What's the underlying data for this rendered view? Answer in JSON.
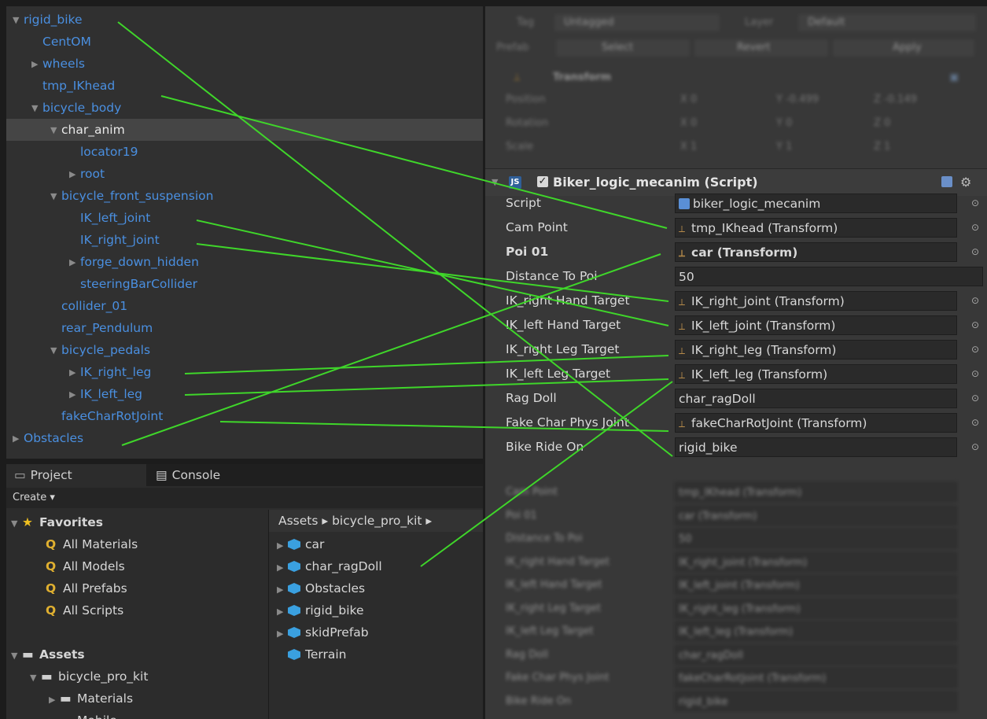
{
  "hierarchy": {
    "items": [
      {
        "label": "rigid_bike",
        "arrow": "open",
        "indent": 0
      },
      {
        "label": "CentOM",
        "arrow": "none",
        "indent": 1
      },
      {
        "label": "wheels",
        "arrow": "closed",
        "indent": 1
      },
      {
        "label": "tmp_IKhead",
        "arrow": "none",
        "indent": 1
      },
      {
        "label": "bicycle_body",
        "arrow": "open",
        "indent": 1
      },
      {
        "label": "char_anim",
        "arrow": "open",
        "indent": 2,
        "selected": true
      },
      {
        "label": "locator19",
        "arrow": "none",
        "indent": 3
      },
      {
        "label": "root",
        "arrow": "closed",
        "indent": 3
      },
      {
        "label": "bicycle_front_suspension",
        "arrow": "open",
        "indent": 2
      },
      {
        "label": "IK_left_joint",
        "arrow": "none",
        "indent": 3
      },
      {
        "label": "IK_right_joint",
        "arrow": "none",
        "indent": 3
      },
      {
        "label": "forge_down_hidden",
        "arrow": "closed",
        "indent": 3
      },
      {
        "label": "steeringBarCollider",
        "arrow": "none",
        "indent": 3
      },
      {
        "label": "collider_01",
        "arrow": "none",
        "indent": 2
      },
      {
        "label": "rear_Pendulum",
        "arrow": "none",
        "indent": 2
      },
      {
        "label": "bicycle_pedals",
        "arrow": "open",
        "indent": 2
      },
      {
        "label": "IK_right_leg",
        "arrow": "closed",
        "indent": 3
      },
      {
        "label": "IK_left_leg",
        "arrow": "closed",
        "indent": 3
      },
      {
        "label": "fakeCharRotJoint",
        "arrow": "none",
        "indent": 2
      },
      {
        "label": "Obstacles",
        "arrow": "closed",
        "indent": 0
      }
    ]
  },
  "inspector": {
    "top_blurred": {
      "tag_label": "Tag",
      "tag_value": "Untagged",
      "layer_label": "Layer",
      "layer_value": "Default",
      "prefab_label": "Prefab",
      "prefab_select": "Select",
      "prefab_revert": "Revert",
      "prefab_apply": "Apply",
      "transform_title": "Transform",
      "position_label": "Position",
      "rotation_label": "Rotation",
      "scale_label": "Scale",
      "pos": [
        "X 0",
        "Y -0.499",
        "Z -0.149"
      ],
      "rot": [
        "X 0",
        "Y 0",
        "Z 0"
      ],
      "scl": [
        "X 1",
        "Y 1",
        "Z 1"
      ]
    },
    "script_header": {
      "title": "Biker_logic_mecanim (Script)",
      "js": "JS",
      "check": "✓"
    },
    "properties": [
      {
        "label": "Script",
        "value": "biker_logic_mecanim",
        "icon": "script"
      },
      {
        "label": "Cam Point",
        "value": "tmp_IKhead (Transform)",
        "icon": "transform"
      },
      {
        "label": "Poi 01",
        "value": "car (Transform)",
        "icon": "transform",
        "bold": true
      },
      {
        "label": "Distance To Poi",
        "value": "50",
        "icon": "none",
        "wide": true
      },
      {
        "label": "IK_right Hand Target",
        "value": "IK_right_joint (Transform)",
        "icon": "transform"
      },
      {
        "label": "IK_left Hand Target",
        "value": "IK_left_joint (Transform)",
        "icon": "transform"
      },
      {
        "label": "IK_right Leg Target",
        "value": "IK_right_leg (Transform)",
        "icon": "transform"
      },
      {
        "label": "IK_left Leg Target",
        "value": "IK_left_leg (Transform)",
        "icon": "transform"
      },
      {
        "label": "Rag Doll",
        "value": "char_ragDoll",
        "icon": "none"
      },
      {
        "label": "Fake Char Phys Joint",
        "value": "fakeCharRotJoint (Transform)",
        "icon": "transform"
      },
      {
        "label": "Bike Ride On",
        "value": "rigid_bike",
        "icon": "none"
      }
    ],
    "blurred_properties": [
      {
        "label": "Cam Point",
        "value": "tmp_IKhead (Transform)"
      },
      {
        "label": "Poi 01",
        "value": "car (Transform)"
      },
      {
        "label": "Distance To Poi",
        "value": "50"
      },
      {
        "label": "IK_right Hand Target",
        "value": "IK_right_joint (Transform)"
      },
      {
        "label": "IK_left Hand Target",
        "value": "IK_left_joint (Transform)"
      },
      {
        "label": "IK_right Leg Target",
        "value": "IK_right_leg (Transform)"
      },
      {
        "label": "IK_left Leg Target",
        "value": "IK_left_leg (Transform)"
      },
      {
        "label": "Rag Doll",
        "value": "char_ragDoll"
      },
      {
        "label": "Fake Char Phys Joint",
        "value": "fakeCharRotJoint (Transform)"
      },
      {
        "label": "Bike Ride On",
        "value": "rigid_bike"
      }
    ]
  },
  "project": {
    "tabs": [
      {
        "label": "Project"
      },
      {
        "label": "Console"
      }
    ],
    "create_label": "Create ▾",
    "favorites_label": "Favorites",
    "favorites": [
      "All Materials",
      "All Models",
      "All Prefabs",
      "All Scripts"
    ],
    "assets_label": "Assets",
    "asset_tree": [
      {
        "label": "bicycle_pro_kit",
        "indent": 1,
        "arrow": "open"
      },
      {
        "label": "Materials",
        "indent": 2,
        "arrow": "closed"
      },
      {
        "label": "Mobile",
        "indent": 2,
        "arrow": "closed"
      }
    ],
    "breadcrumb": "Assets ▸ bicycle_pro_kit ▸",
    "files": [
      {
        "label": "car",
        "arrow": true
      },
      {
        "label": "char_ragDoll",
        "arrow": true
      },
      {
        "label": "Obstacles",
        "arrow": true
      },
      {
        "label": "rigid_bike",
        "arrow": true
      },
      {
        "label": "skidPrefab",
        "arrow": true
      },
      {
        "label": "Terrain",
        "arrow": false
      }
    ]
  },
  "colors": {
    "link_line": "#3fd62a",
    "hier_text": "#4a8fe0"
  }
}
